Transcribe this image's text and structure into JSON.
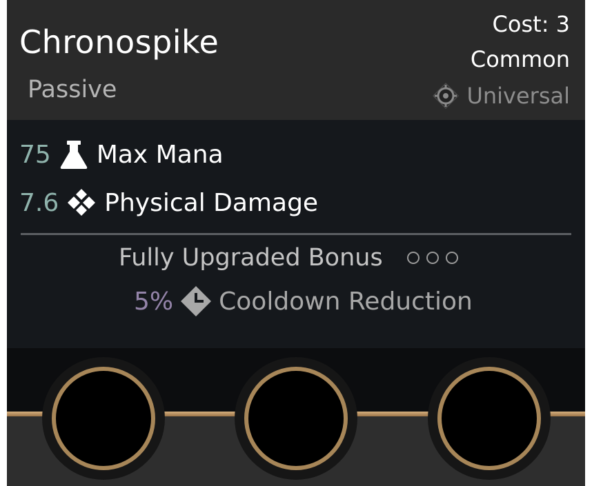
{
  "item": {
    "name": "Chronospike",
    "type": "Passive",
    "cost_label": "Cost: 3",
    "rarity": "Common",
    "category": "Universal",
    "category_icon": "crosshair-emblem-icon"
  },
  "stats": [
    {
      "value": "75",
      "icon": "flask-icon",
      "label": "Max Mana"
    },
    {
      "value": "7.6",
      "icon": "physical-damage-diamonds-icon",
      "label": "Physical Damage"
    }
  ],
  "bonus": {
    "title": "Fully Upgraded Bonus",
    "pips_filled": 0,
    "pips_total": 3,
    "value": "5%",
    "icon": "cooldown-clock-diamond-icon",
    "label": "Cooldown Reduction"
  },
  "sockets": {
    "count": 3,
    "filled": 0
  },
  "colors": {
    "header_bg": "#2a2a2a",
    "body_bg": "#15181c",
    "stat_value": "#8fb3ac",
    "bonus_value": "#9383a8",
    "socket_ring": "#a78658"
  }
}
